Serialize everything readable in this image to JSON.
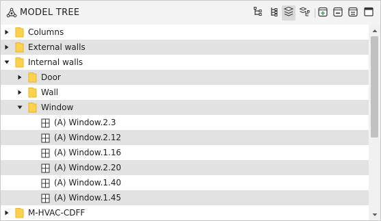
{
  "panel": {
    "title": "MODEL TREE",
    "title_icon": "model-tree-icon",
    "toolbar": [
      {
        "name": "hierarchy-icon",
        "active": false
      },
      {
        "name": "tree-list-icon",
        "active": false
      },
      {
        "name": "layers-icon",
        "active": true
      },
      {
        "name": "layer-group-icon",
        "active": false
      },
      {
        "name": "add-group-icon",
        "active": false
      },
      {
        "name": "remove-group-icon",
        "active": false
      },
      {
        "name": "clear-group-icon",
        "active": false
      },
      {
        "name": "window-panel-icon",
        "active": false
      }
    ]
  },
  "tree": {
    "items": [
      {
        "label": "Columns",
        "level": 0,
        "type": "folder",
        "state": "collapsed"
      },
      {
        "label": "External walls",
        "level": 0,
        "type": "folder",
        "state": "collapsed"
      },
      {
        "label": "Internal walls",
        "level": 0,
        "type": "folder",
        "state": "expanded"
      },
      {
        "label": "Door",
        "level": 1,
        "type": "folder",
        "state": "collapsed"
      },
      {
        "label": "Wall",
        "level": 1,
        "type": "folder",
        "state": "collapsed"
      },
      {
        "label": "Window",
        "level": 1,
        "type": "folder",
        "state": "expanded"
      },
      {
        "label": "(A) Window.2.3",
        "level": 2,
        "type": "element"
      },
      {
        "label": "(A) Window.2.12",
        "level": 2,
        "type": "element"
      },
      {
        "label": "(A) Window.1.16",
        "level": 2,
        "type": "element"
      },
      {
        "label": "(A) Window.2.20",
        "level": 2,
        "type": "element"
      },
      {
        "label": "(A) Window.1.40",
        "level": 2,
        "type": "element"
      },
      {
        "label": "(A) Window.1.45",
        "level": 2,
        "type": "element"
      },
      {
        "label": "M-HVAC-CDFF",
        "level": 0,
        "type": "folder",
        "state": "collapsed"
      }
    ]
  },
  "colors": {
    "folder": "#ffd24d",
    "folder_edge": "#e8b428",
    "row_alt": "#e2e2e2",
    "header_bg": "#f3f3f3",
    "accent_green": "#3aa35a",
    "scroll_thumb": "#c1c1c1"
  }
}
